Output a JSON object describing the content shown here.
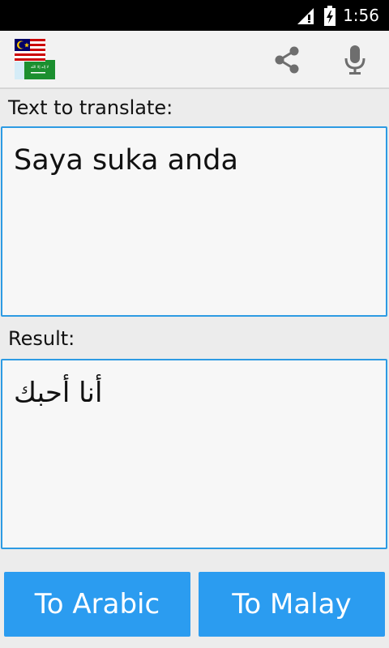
{
  "status_bar": {
    "time": "1:56"
  },
  "toolbar": {
    "icons": [
      "malay-saudi-flags-icon",
      "share-icon",
      "microphone-icon"
    ],
    "app_icon_text": "لا إله إلا الله"
  },
  "input": {
    "label": "Text to translate:",
    "value": "Saya suka anda"
  },
  "result": {
    "label": "Result:",
    "value": "أنا أحبك"
  },
  "buttons": {
    "to_arabic": "To Arabic",
    "to_malay": "To Malay"
  },
  "colors": {
    "accent": "#2b9cf0",
    "border": "#2d9be3"
  }
}
